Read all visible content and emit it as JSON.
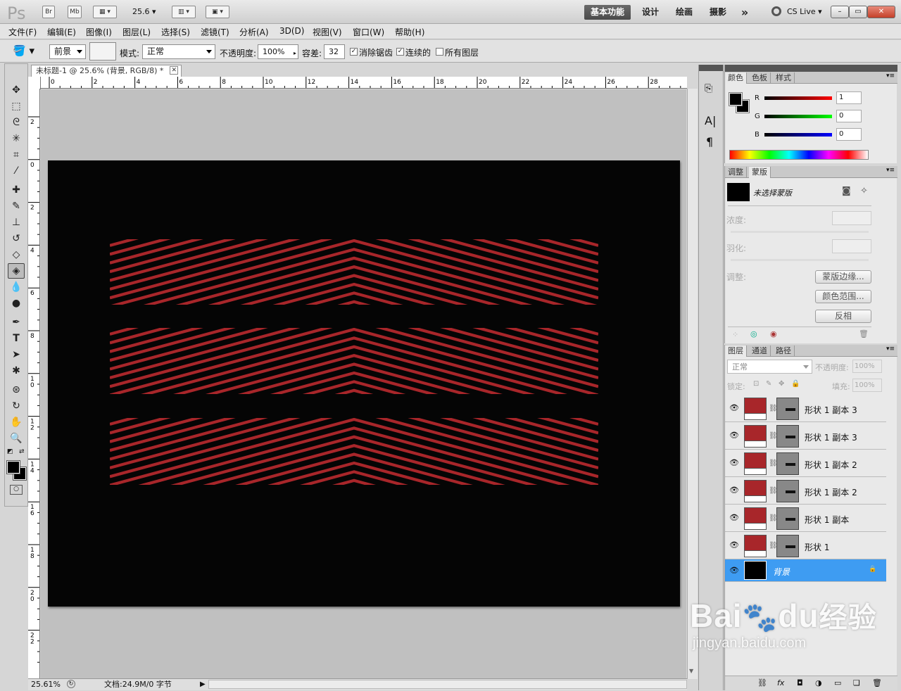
{
  "app": {
    "logo": "Ps",
    "bridge_label": "Br",
    "minibridge_label": "Mb",
    "zoom_combo": "25.6",
    "workspaces": [
      "基本功能",
      "设计",
      "绘画",
      "摄影"
    ],
    "more_label": "»",
    "cs_live": "CS Live",
    "window_buttons": [
      "–",
      "▭",
      "✕"
    ]
  },
  "menu": [
    "文件(F)",
    "编辑(E)",
    "图像(I)",
    "图层(L)",
    "选择(S)",
    "滤镜(T)",
    "分析(A)",
    "3D(D)",
    "视图(V)",
    "窗口(W)",
    "帮助(H)"
  ],
  "options": {
    "fill_source": "前景",
    "mode_label": "模式:",
    "mode_value": "正常",
    "opacity_label": "不透明度:",
    "opacity_value": "100%",
    "tolerance_label": "容差:",
    "tolerance_value": "32",
    "antialias_label": "消除锯齿",
    "contiguous_label": "连续的",
    "all_layers_label": "所有图层"
  },
  "document": {
    "tab_title": "未标题-1 @ 25.6% (背景, RGB/8) *",
    "ruler_h_labels": [
      "0",
      "2",
      "4",
      "6",
      "8",
      "10",
      "12",
      "14",
      "16",
      "18",
      "20",
      "22",
      "24",
      "26",
      "28"
    ],
    "ruler_v_labels": [
      "2",
      "0",
      "2",
      "4",
      "6",
      "8",
      "10",
      "12",
      "14",
      "16",
      "18",
      "20",
      "22"
    ],
    "zoom_status": "25.61%",
    "doc_info": "文档:24.9M/0 字节",
    "pattern_color": "#a8262a"
  },
  "color_panel": {
    "tabs": [
      "颜色",
      "色板",
      "样式"
    ],
    "channels": [
      {
        "name": "R",
        "value": "1"
      },
      {
        "name": "G",
        "value": "0"
      },
      {
        "name": "B",
        "value": "0"
      }
    ]
  },
  "masks_panel": {
    "tabs": [
      "调整",
      "蒙版"
    ],
    "title": "未选择蒙版",
    "density_label": "浓度:",
    "feather_label": "羽化:",
    "refine_label": "调整:",
    "buttons": [
      "蒙版边缘...",
      "颜色范围...",
      "反相"
    ]
  },
  "layers_panel": {
    "tabs": [
      "图层",
      "通道",
      "路径"
    ],
    "blend_mode": "正常",
    "opacity_label": "不透明度:",
    "opacity_value": "100%",
    "lock_label": "锁定:",
    "fill_label": "填充:",
    "fill_value": "100%",
    "layers": [
      {
        "name": "形状 1 副本 3"
      },
      {
        "name": "形状 1 副本 3"
      },
      {
        "name": "形状 1 副本 2"
      },
      {
        "name": "形状 1 副本 2"
      },
      {
        "name": "形状 1 副本"
      },
      {
        "name": "形状 1"
      },
      {
        "name": "背景",
        "active": true
      }
    ],
    "footer_icons": [
      "link-icon",
      "fx-icon",
      "mask-icon",
      "adjustment-icon",
      "group-icon",
      "new-layer-icon",
      "trash-icon"
    ]
  },
  "watermark": {
    "brand": "Bai",
    "brand2": "du",
    "cn": "经验",
    "url": "jingyan.baidu.com"
  }
}
